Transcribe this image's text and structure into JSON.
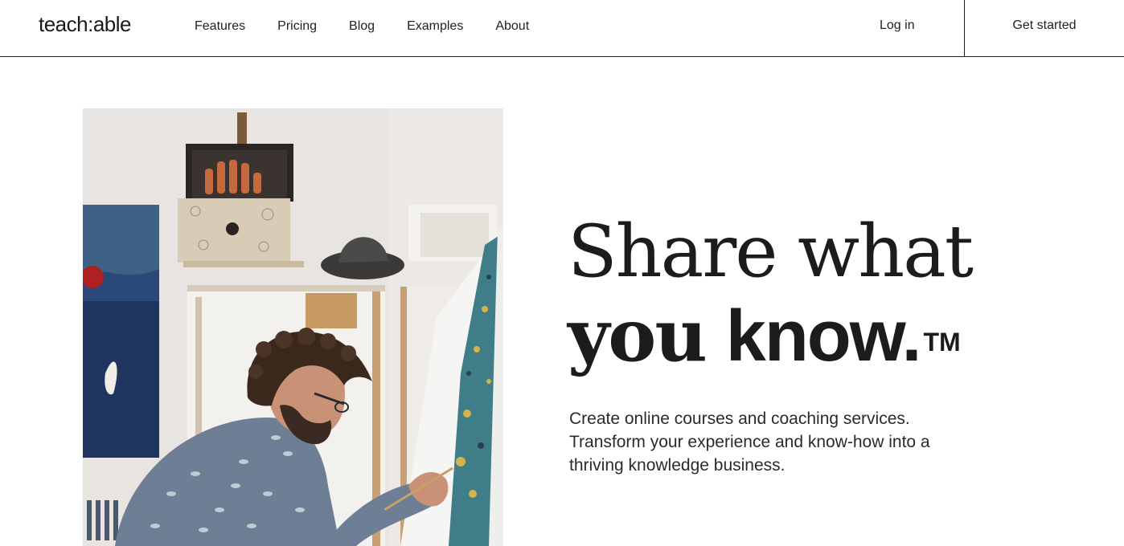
{
  "brand": {
    "logo_text": "teach:able"
  },
  "nav": {
    "links": [
      {
        "label": "Features"
      },
      {
        "label": "Pricing"
      },
      {
        "label": "Blog"
      },
      {
        "label": "Examples"
      },
      {
        "label": "About"
      }
    ],
    "login_label": "Log in",
    "cta_label": "Get started"
  },
  "hero": {
    "headline_line1": "Share what",
    "headline_line2_serif": "you",
    "headline_line2_sans": "know.",
    "trademark": "TM",
    "subtext": "Create online courses and coaching services. Transform your experience and know-how into a thriving knowledge business.",
    "photo_subject": "artist-painting-photo"
  },
  "colors": {
    "text": "#1f1f1f",
    "background": "#ffffff",
    "border": "#1f1f1f"
  }
}
